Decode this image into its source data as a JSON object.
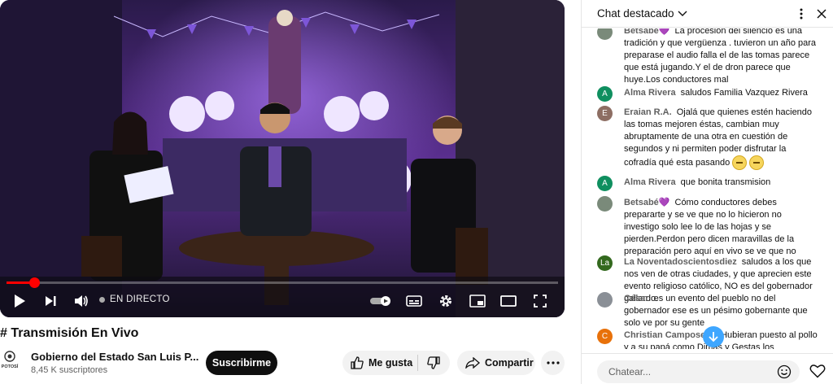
{
  "video": {
    "title": "# Transmisión En Vivo",
    "live_label": "EN DIRECTO",
    "progress_fraction": 0.05
  },
  "channel": {
    "name": "Gobierno del Estado San Luis P...",
    "subscribers": "8,45 K suscriptores",
    "logo_text": "POTOSÍ",
    "subscribe_label": "Suscribirme"
  },
  "actions": {
    "like_label": "Me gusta",
    "share_label": "Compartir"
  },
  "chat": {
    "title": "Chat destacado",
    "input_placeholder": "Chatear...",
    "messages": [
      {
        "author": "Betsabé💜",
        "text": "La procesión del silencio es una tradición y que vergüenza . tuvieron un año para preparase el audio falla el de las tomas parece que está jugando.Y el de dron parece que huye.Los conductores mal",
        "avatar": "",
        "avatar_color": "#7a8a7a"
      },
      {
        "author": "Alma Rivera",
        "text": "saludos Familia Vazquez Rivera",
        "avatar": "A",
        "avatar_color": "#0f8f5f"
      },
      {
        "author": "Eraian R.A.",
        "text": "Ojalá que quienes estén haciendo las tomas mejoren éstas, cambian muy abruptamente de una otra en cuestión de segundos y ni permiten poder disfrutar la cofradía qué esta pasando",
        "avatar": "E",
        "avatar_color": "#8d6e63"
      },
      {
        "author": "Alma Rivera",
        "text": "que bonita transmision",
        "avatar": "A",
        "avatar_color": "#0f8f5f"
      },
      {
        "author": "Betsabé💜",
        "text": "Cómo conductores debes prepararte y se ve que no lo hicieron no investigo solo lee lo de las hojas y se pierden.Perdon pero dicen maravillas de la preparación pero aquí en vivo se ve que no",
        "avatar": "",
        "avatar_color": "#7a8a7a"
      },
      {
        "author": "La Noventadoscientosdiez",
        "text": "saludos a los que nos ven de otras ciudades, y que aprecien este evento religioso católico, NO es del gobernador gallardo.",
        "avatar": "La",
        "avatar_color": "#33691e"
      },
      {
        "author": "César",
        "text": "es un evento del pueblo no del gobernador ese es un pésimo gobernante que solo ve por su gente",
        "avatar": "",
        "avatar_color": "#8a8f96"
      },
      {
        "author": "Christian Camposeco",
        "text": "Hubieran puesto al pollo y a su papá como Dimas y Gestas los ladronzuelos",
        "avatar": "C",
        "avatar_color": "#e8710a"
      }
    ]
  },
  "icons": {
    "play": "play-icon",
    "next": "next-icon",
    "volume": "volume-icon",
    "autoplay": "autoplay-toggle-icon",
    "captions": "captions-icon",
    "settings": "gear-icon",
    "miniplayer": "miniplayer-icon",
    "theater": "theater-icon",
    "fullscreen": "fullscreen-icon",
    "like": "thumbs-up-icon",
    "dislike": "thumbs-down-icon",
    "share": "share-icon",
    "more": "more-horizontal-icon",
    "chat_kebab": "more-vertical-icon",
    "chat_close": "close-icon",
    "scroll": "arrow-down-icon",
    "emoji": "emoji-icon",
    "heart": "heart-icon"
  },
  "colors": {
    "progress": "#ff0000",
    "subscribe_bg": "#0f0f0f",
    "scroll_button": "#3ea6ff"
  }
}
